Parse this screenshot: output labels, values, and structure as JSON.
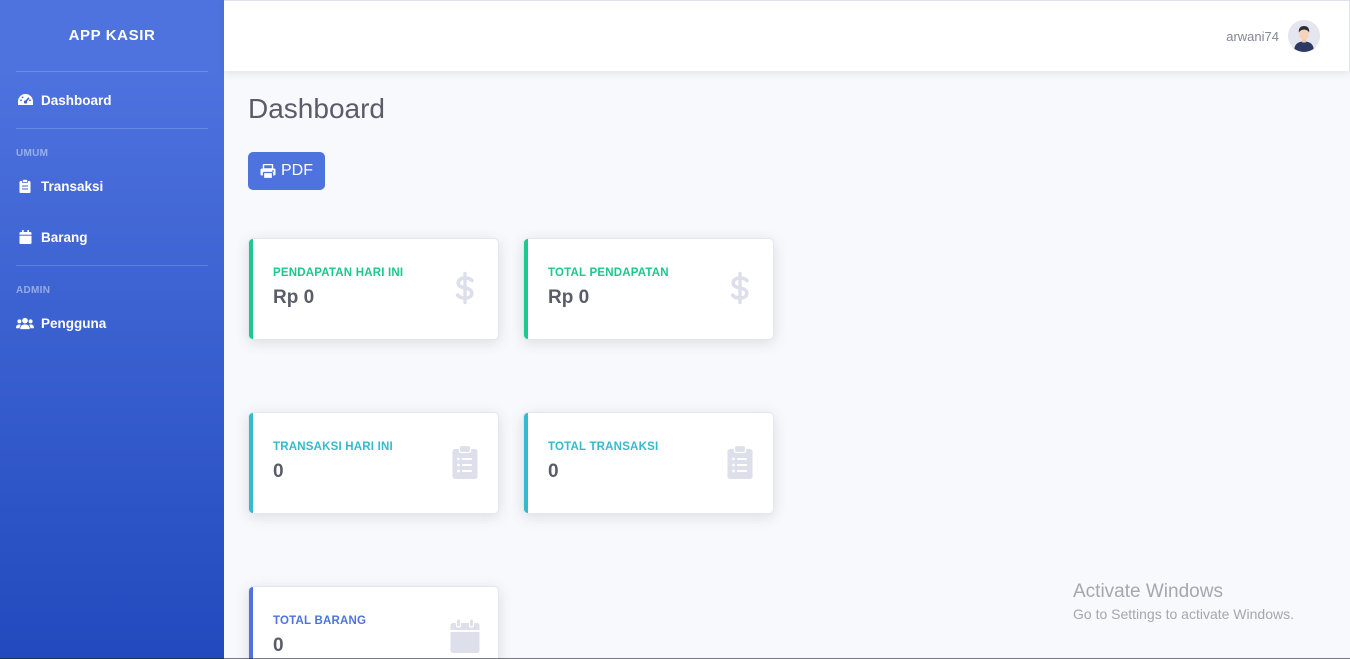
{
  "sidebar": {
    "brand": "APP KASIR",
    "items": [
      {
        "label": "Dashboard",
        "icon": "tachometer-icon"
      },
      {
        "heading": "UMUM"
      },
      {
        "label": "Transaksi",
        "icon": "clipboard-icon"
      },
      {
        "label": "Barang",
        "icon": "calendar-icon"
      },
      {
        "heading": "ADMIN"
      },
      {
        "label": "Pengguna",
        "icon": "users-icon"
      }
    ]
  },
  "topbar": {
    "username": "arwani74",
    "avatar_icon": "user-avatar-icon"
  },
  "main": {
    "title": "Dashboard",
    "pdf_label": "PDF",
    "pdf_icon": "print-icon",
    "cards": [
      {
        "label": "PENDAPATAN HARI INI",
        "value": "Rp 0",
        "icon": "dollar-icon",
        "accent": "#1cc88a"
      },
      {
        "label": "TOTAL PENDAPATAN",
        "value": "Rp 0",
        "icon": "dollar-icon",
        "accent": "#1cc88a"
      },
      {
        "label": "TRANSAKSI HARI INI",
        "value": "0",
        "icon": "clipboard-list-icon",
        "accent": "#36b9cc"
      },
      {
        "label": "TOTAL TRANSAKSI",
        "value": "0",
        "icon": "clipboard-list-icon",
        "accent": "#36b9cc"
      },
      {
        "label": "TOTAL BARANG",
        "value": "0",
        "icon": "calendar-icon",
        "accent": "#4e73df"
      }
    ]
  },
  "watermark": {
    "line1": "Activate Windows",
    "line2": "Go to Settings to activate Windows."
  },
  "colors": {
    "primary": "#4e73df",
    "success": "#1cc88a",
    "info": "#36b9cc",
    "text": "#5a5c69",
    "icon_muted": "#dddfeb"
  }
}
